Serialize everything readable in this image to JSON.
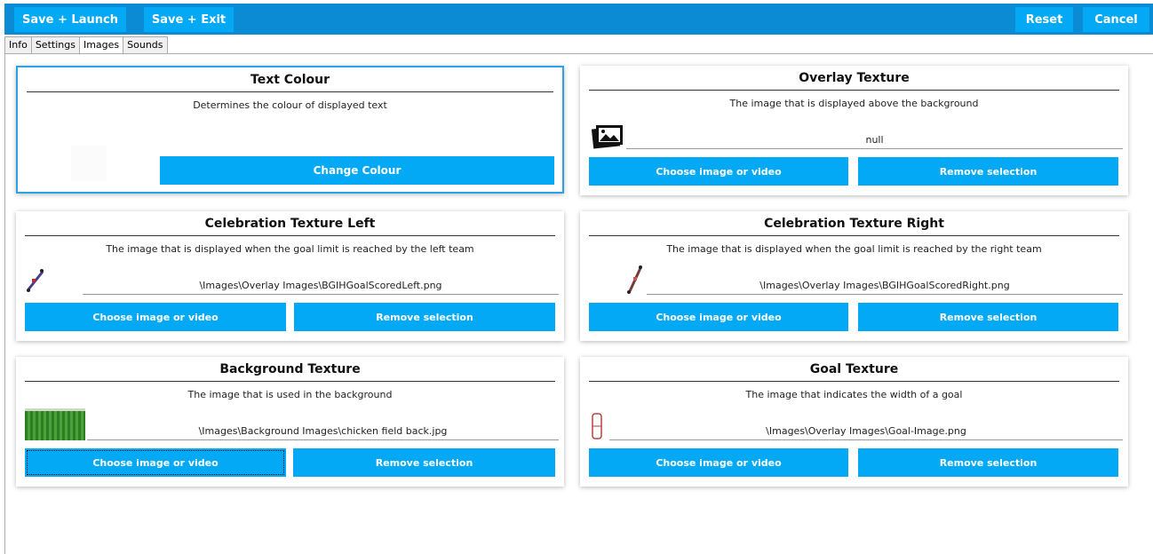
{
  "toolbar": {
    "save_launch": "Save + Launch",
    "save_exit": "Save + Exit",
    "reset": "Reset",
    "cancel": "Cancel"
  },
  "tabs": [
    "Info",
    "Settings",
    "Images",
    "Sounds"
  ],
  "active_tab": "Images",
  "cards": {
    "text_colour": {
      "title": "Text Colour",
      "description": "Determines the colour of displayed text",
      "button": "Change Colour"
    },
    "overlay": {
      "title": "Overlay Texture",
      "description": "The image that is displayed above the background",
      "path": "null",
      "choose": "Choose image or video",
      "remove": "Remove selection"
    },
    "celebration_left": {
      "title": "Celebration Texture Left",
      "description": "The image that is displayed when the goal limit is reached by the left team",
      "path": "\\Images\\Overlay Images\\BGIHGoalScoredLeft.png",
      "choose": "Choose image or video",
      "remove": "Remove selection"
    },
    "celebration_right": {
      "title": "Celebration Texture Right",
      "description": "The image that is displayed when the goal limit is reached by the right team",
      "path": "\\Images\\Overlay Images\\BGIHGoalScoredRight.png",
      "choose": "Choose image or video",
      "remove": "Remove selection"
    },
    "background": {
      "title": "Background Texture",
      "description": "The image that is used in the background",
      "path": "\\Images\\Background Images\\chicken field back.jpg",
      "choose": "Choose image or video",
      "remove": "Remove selection"
    },
    "goal": {
      "title": "Goal Texture",
      "description": "The image that indicates the width of a goal",
      "path": "\\Images\\Overlay Images\\Goal-Image.png",
      "choose": "Choose image or video",
      "remove": "Remove selection"
    }
  },
  "colors": {
    "accent": "#03a9f4",
    "topbar": "#0a8bd4"
  }
}
